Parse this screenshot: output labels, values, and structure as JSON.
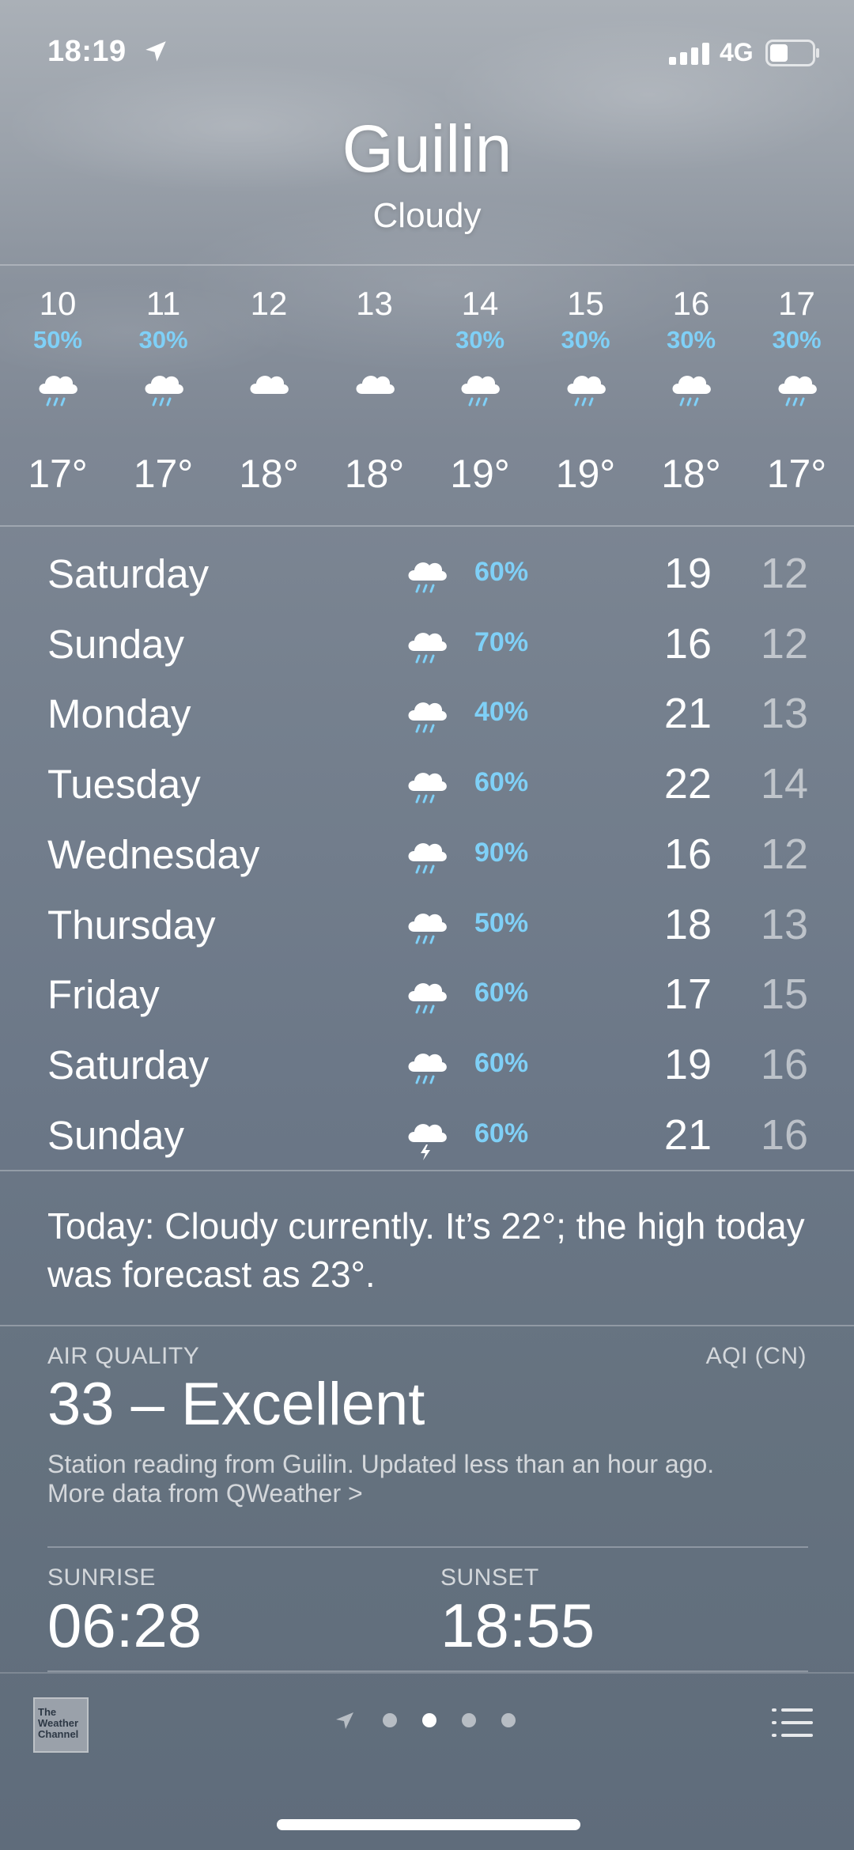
{
  "status_bar": {
    "time": "18:19",
    "network": "4G",
    "location_icon": "location-arrow-icon",
    "signal_icon": "signal-bars-icon",
    "battery_icon": "battery-icon"
  },
  "header": {
    "city": "Guilin",
    "condition": "Cloudy"
  },
  "hourly": [
    {
      "hour": "10",
      "pop": "50%",
      "icon": "cloud-rain-icon",
      "temp": "17°"
    },
    {
      "hour": "11",
      "pop": "30%",
      "icon": "cloud-rain-icon",
      "temp": "17°"
    },
    {
      "hour": "12",
      "pop": "",
      "icon": "cloud-icon",
      "temp": "18°"
    },
    {
      "hour": "13",
      "pop": "",
      "icon": "cloud-icon",
      "temp": "18°"
    },
    {
      "hour": "14",
      "pop": "30%",
      "icon": "cloud-rain-icon",
      "temp": "19°"
    },
    {
      "hour": "15",
      "pop": "30%",
      "icon": "cloud-rain-icon",
      "temp": "19°"
    },
    {
      "hour": "16",
      "pop": "30%",
      "icon": "cloud-rain-icon",
      "temp": "18°"
    },
    {
      "hour": "17",
      "pop": "30%",
      "icon": "cloud-rain-icon",
      "temp": "17°"
    }
  ],
  "daily": [
    {
      "day": "Saturday",
      "icon": "cloud-rain-icon",
      "pop": "60%",
      "high": "19",
      "low": "12"
    },
    {
      "day": "Sunday",
      "icon": "cloud-rain-icon",
      "pop": "70%",
      "high": "16",
      "low": "12"
    },
    {
      "day": "Monday",
      "icon": "cloud-rain-icon",
      "pop": "40%",
      "high": "21",
      "low": "13"
    },
    {
      "day": "Tuesday",
      "icon": "cloud-rain-icon",
      "pop": "60%",
      "high": "22",
      "low": "14"
    },
    {
      "day": "Wednesday",
      "icon": "cloud-rain-icon",
      "pop": "90%",
      "high": "16",
      "low": "12"
    },
    {
      "day": "Thursday",
      "icon": "cloud-rain-icon",
      "pop": "50%",
      "high": "18",
      "low": "13"
    },
    {
      "day": "Friday",
      "icon": "cloud-rain-icon",
      "pop": "60%",
      "high": "17",
      "low": "15"
    },
    {
      "day": "Saturday",
      "icon": "cloud-rain-icon",
      "pop": "60%",
      "high": "19",
      "low": "16"
    },
    {
      "day": "Sunday",
      "icon": "cloud-thunder-icon",
      "pop": "60%",
      "high": "21",
      "low": "16"
    }
  ],
  "summary": "Today: Cloudy currently. It’s 22°; the high today was forecast as 23°.",
  "air_quality": {
    "label": "AIR QUALITY",
    "scale": "AQI (CN)",
    "value": "33 – Excellent",
    "description": "Station reading from Guilin. Updated less than an hour ago.",
    "link": "More data from QWeather >"
  },
  "sun": {
    "sunrise_label": "SUNRISE",
    "sunrise": "06:28",
    "sunset_label": "SUNSET",
    "sunset": "18:55"
  },
  "bottom_bar": {
    "logo_text": "The Weather Channel",
    "page_count": 4,
    "current_page": 2,
    "list_icon": "list-icon"
  },
  "colors": {
    "precip": "#7fd0f7",
    "low_temp": "rgba(255,255,255,0.55)"
  }
}
